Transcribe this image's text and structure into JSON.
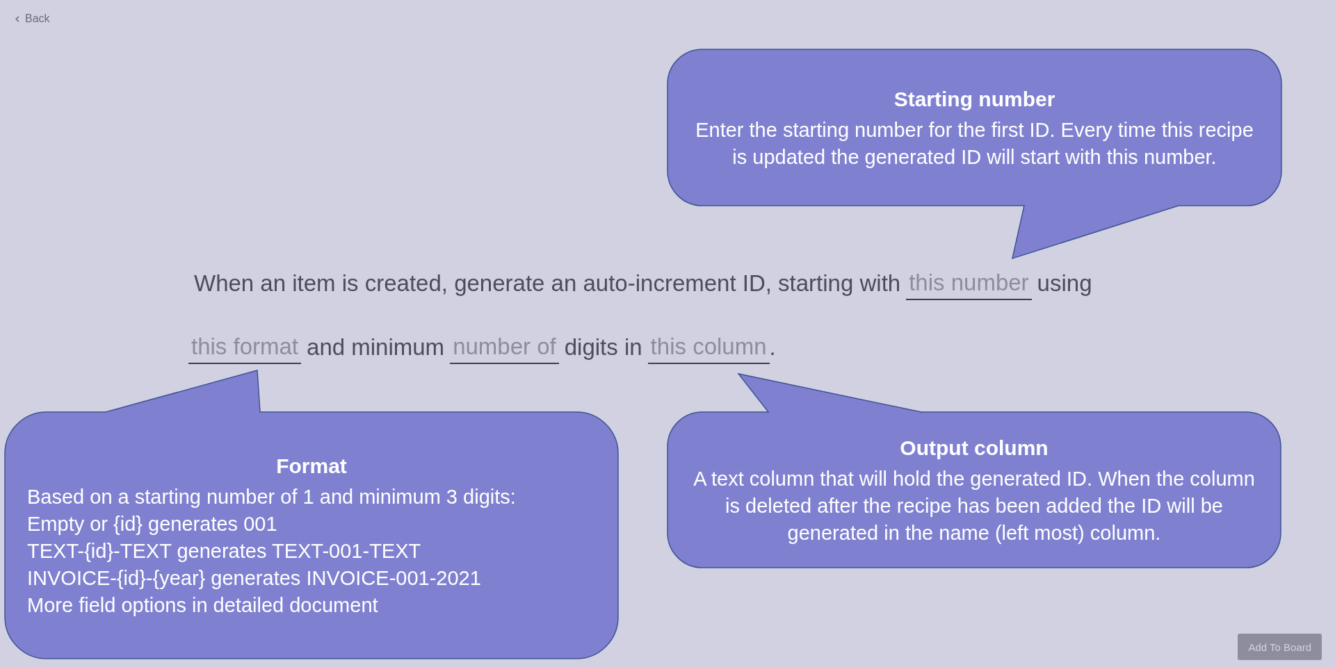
{
  "back": {
    "label": "Back"
  },
  "callouts": [
    {
      "title": "Starting number",
      "kind": "paragraph",
      "text": "Enter the starting number for the first ID. Every time this recipe is updated the generated ID will start with this number."
    },
    {
      "title": "Format",
      "kind": "list",
      "lines": [
        "Based on a starting number of 1 and minimum 3 digits:",
        "Empty or {id} generates 001",
        "TEXT-{id}-TEXT generates TEXT-001-TEXT",
        "INVOICE-{id}-{year} generates INVOICE-001-2021",
        "More field options in detailed document"
      ]
    },
    {
      "title": "Output column",
      "kind": "paragraph",
      "text": "A text column that will hold the generated ID. When the column is deleted after the recipe has been added the ID will be generated in the name (left most) column."
    }
  ],
  "sentence": [
    {
      "kind": "text",
      "text": "When an item is created, generate an auto-increment ID, starting with"
    },
    {
      "kind": "field",
      "placeholder": "this number"
    },
    {
      "kind": "text",
      "text": "using"
    },
    {
      "kind": "field",
      "placeholder": "this format"
    },
    {
      "kind": "text",
      "text": "and minimum"
    },
    {
      "kind": "field",
      "placeholder": "number of"
    },
    {
      "kind": "text",
      "text": "digits in"
    },
    {
      "kind": "field",
      "placeholder": "this column"
    },
    {
      "kind": "punct",
      "text": "."
    }
  ],
  "add_button": {
    "label": "Add To Board",
    "disabled": true
  }
}
